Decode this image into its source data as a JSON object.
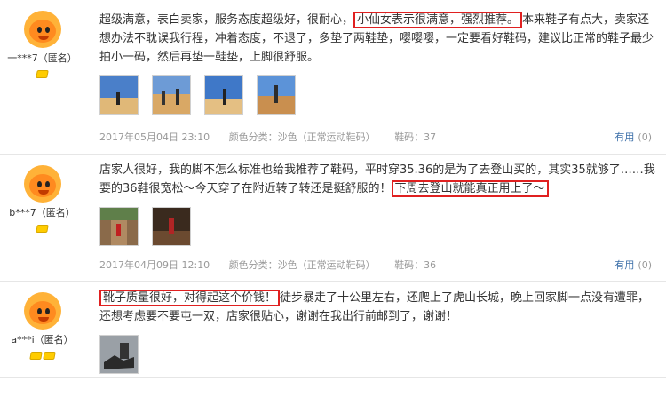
{
  "reviews": [
    {
      "user": "一***7（匿名）",
      "badges": 1,
      "text_before": "超级满意，表白卖家，服务态度超级好，很耐心，",
      "text_highlight": "小仙女表示很满意，强烈推荐。",
      "text_after": "本来鞋子有点大，卖家还想办法不耽误我行程，冲着态度，不退了，多垫了两鞋垫，嘤嘤嘤，一定要看好鞋码，建议比正常的鞋子最少拍小一码，然后再垫一鞋垫，上脚很舒服。",
      "photos": [
        "desert-photo",
        "desert-photo",
        "desert-photo",
        "desert-photo"
      ],
      "date": "2017年05月04日 23:10",
      "color_label": "颜色分类：沙色（正常运动鞋码）",
      "size_label": "鞋码：37",
      "useful_label": "有用",
      "useful_count": "(0)"
    },
    {
      "user": "b***7（匿名）",
      "badges": 1,
      "text_before": "店家人很好，我的脚不怎么标准也给我推荐了鞋码，平时穿35.36的是为了去登山买的，其实35就够了……我要的36鞋很宽松～今天穿了在附近转了转还是挺舒服的！",
      "text_highlight": "下周去登山就能真正用上了～",
      "text_after": "",
      "photos": [
        "dirt-road-photo",
        "night-photo"
      ],
      "date": "2017年04月09日 12:10",
      "color_label": "颜色分类：沙色（正常运动鞋码）",
      "size_label": "鞋码：36",
      "useful_label": "有用",
      "useful_count": "(0)"
    },
    {
      "user": "a***i（匿名）",
      "badges": 2,
      "text_before": "",
      "text_highlight": "靴子质量很好，对得起这个价钱！",
      "text_after": "徒步暴走了十公里左右，还爬上了虎山长城，晚上回家脚一点没有遭罪，还想考虑要不要屯一双，店家很贴心，谢谢在我出行前邮到了，谢谢！",
      "photos": [
        "boots-photo"
      ]
    }
  ],
  "colors": {
    "highlight_border": "#e02020",
    "link": "#3a6ea8",
    "meta": "#999999"
  }
}
